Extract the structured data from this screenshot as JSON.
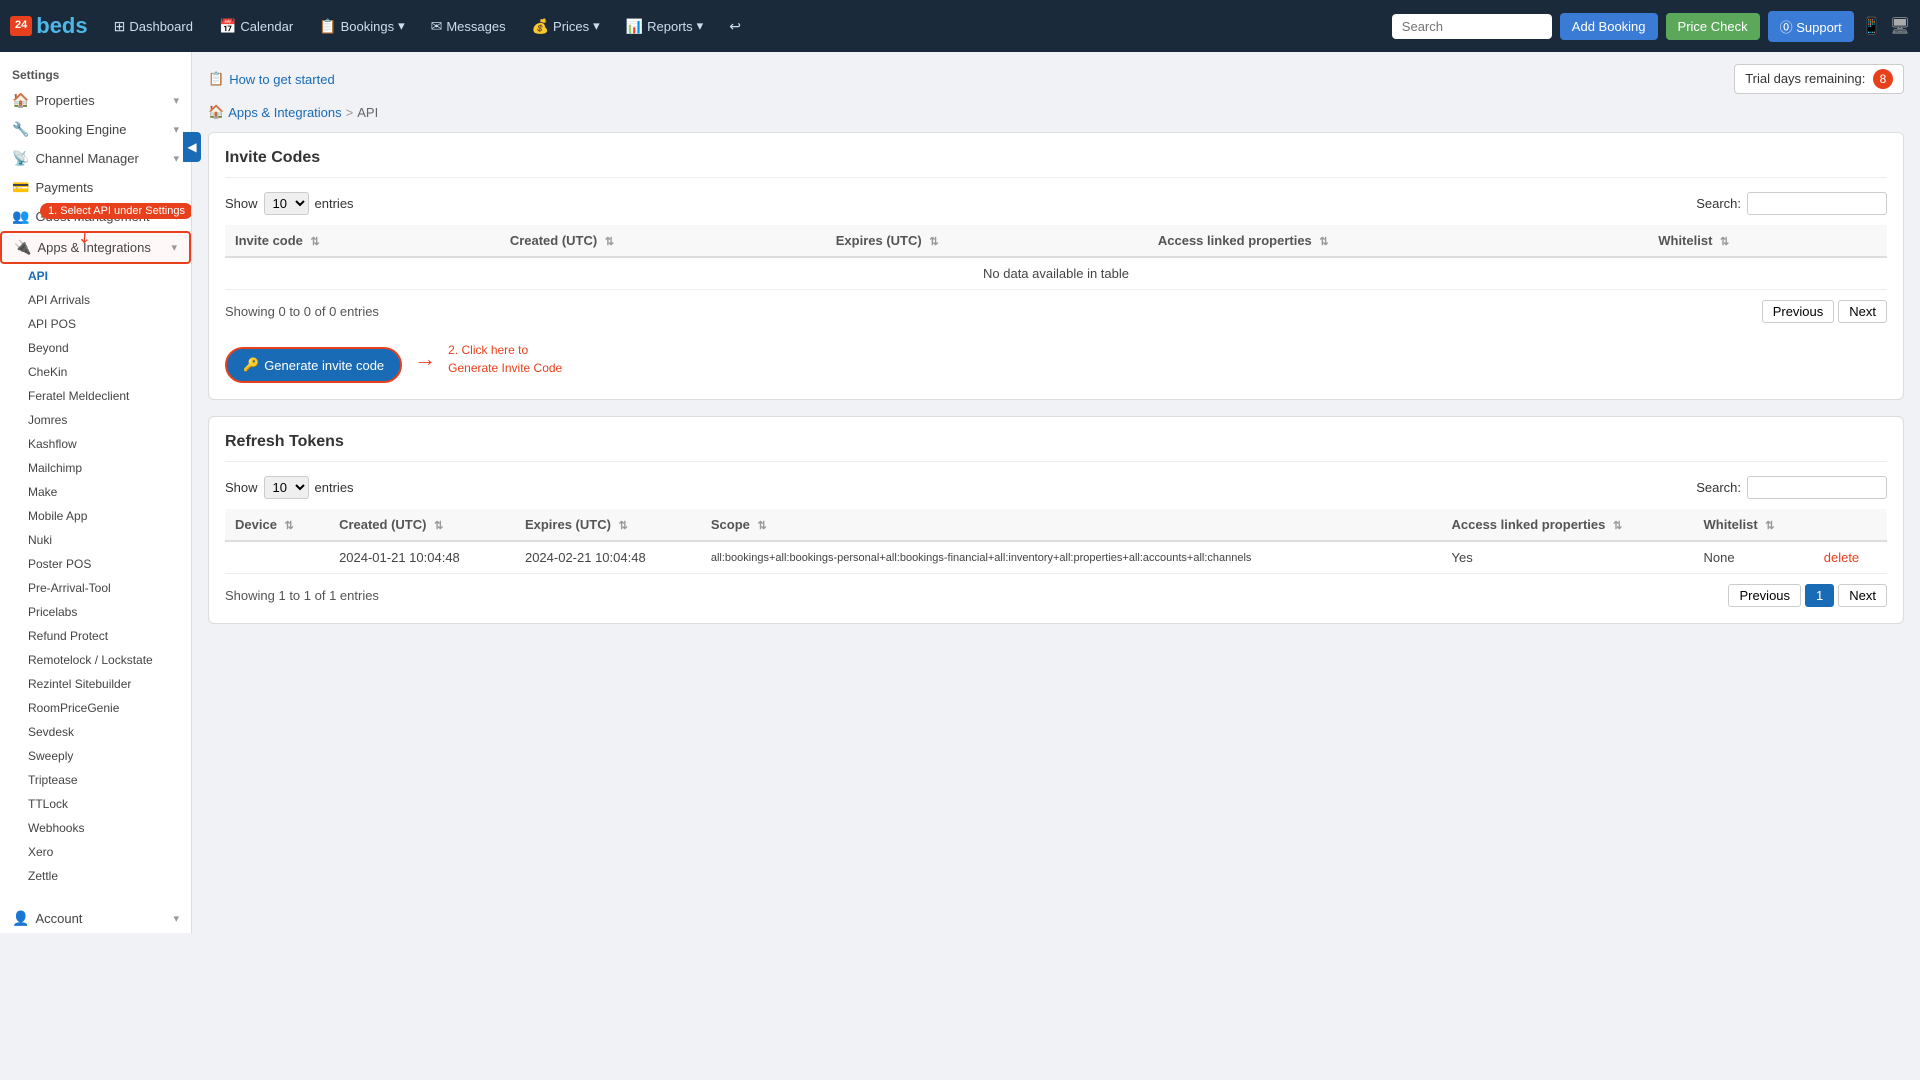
{
  "app": {
    "logo_top": "24",
    "logo_bottom": "beds"
  },
  "topnav": {
    "items": [
      {
        "id": "dashboard",
        "icon": "⊞",
        "label": "Dashboard"
      },
      {
        "id": "calendar",
        "icon": "📅",
        "label": "Calendar"
      },
      {
        "id": "bookings",
        "icon": "📋",
        "label": "Bookings",
        "dropdown": true
      },
      {
        "id": "messages",
        "icon": "✉",
        "label": "Messages"
      },
      {
        "id": "prices",
        "icon": "💰",
        "label": "Prices",
        "dropdown": true
      },
      {
        "id": "reports",
        "icon": "📊",
        "label": "Reports",
        "dropdown": true
      },
      {
        "id": "history",
        "icon": "↩",
        "label": ""
      }
    ],
    "search_placeholder": "Search",
    "add_booking_label": "Add Booking",
    "price_check_label": "Price Check",
    "support_label": "⓪ Support"
  },
  "trial": {
    "label": "Trial days remaining:",
    "days": "8"
  },
  "how_to": {
    "label": "How to get started"
  },
  "breadcrumb": {
    "parts": [
      "Apps & Integrations",
      ">",
      "API"
    ]
  },
  "sidebar": {
    "settings_label": "Settings",
    "items": [
      {
        "id": "properties",
        "icon": "🏠",
        "label": "Properties",
        "has_arrow": true
      },
      {
        "id": "booking-engine",
        "icon": "🔧",
        "label": "Booking Engine",
        "has_arrow": true
      },
      {
        "id": "channel-manager",
        "icon": "📡",
        "label": "Channel Manager",
        "has_arrow": true
      },
      {
        "id": "payments",
        "icon": "💳",
        "label": "Payments",
        "has_arrow": false
      },
      {
        "id": "guest-management",
        "icon": "👥",
        "label": "Guest Management",
        "has_arrow": true
      },
      {
        "id": "apps-integrations",
        "icon": "🔌",
        "label": "Apps & Integrations",
        "has_arrow": true,
        "active": true
      }
    ],
    "sub_items": [
      {
        "id": "api",
        "label": "API",
        "active": true
      },
      {
        "id": "api-arrivals",
        "label": "API Arrivals"
      },
      {
        "id": "api-pos",
        "label": "API POS"
      },
      {
        "id": "beyond",
        "label": "Beyond"
      },
      {
        "id": "chekin",
        "label": "CheKin"
      },
      {
        "id": "feratel",
        "label": "Feratel Meldeclient"
      },
      {
        "id": "jomres",
        "label": "Jomres"
      },
      {
        "id": "kashflow",
        "label": "Kashflow"
      },
      {
        "id": "mailchimp",
        "label": "Mailchimp"
      },
      {
        "id": "make",
        "label": "Make"
      },
      {
        "id": "mobile-app",
        "label": "Mobile App"
      },
      {
        "id": "nuki",
        "label": "Nuki"
      },
      {
        "id": "poster-pos",
        "label": "Poster POS"
      },
      {
        "id": "pre-arrival-tool",
        "label": "Pre-Arrival-Tool"
      },
      {
        "id": "pricelabs",
        "label": "Pricelabs"
      },
      {
        "id": "refund-protect",
        "label": "Refund Protect"
      },
      {
        "id": "remotelock",
        "label": "Remotelock / Lockstate"
      },
      {
        "id": "rezintel",
        "label": "Rezintel Sitebuilder"
      },
      {
        "id": "roompricegenie",
        "label": "RoomPriceGenie"
      },
      {
        "id": "sevdesk",
        "label": "Sevdesk"
      },
      {
        "id": "sweeply",
        "label": "Sweeply"
      },
      {
        "id": "triptease",
        "label": "Triptease"
      },
      {
        "id": "ttlock",
        "label": "TTLock"
      },
      {
        "id": "webhooks",
        "label": "Webhooks"
      },
      {
        "id": "xero",
        "label": "Xero"
      },
      {
        "id": "zettle",
        "label": "Zettle"
      }
    ],
    "account_label": "Account"
  },
  "invite_codes": {
    "title": "Invite Codes",
    "show_label": "Show",
    "show_value": "10",
    "entries_label": "entries",
    "search_label": "Search:",
    "search_value": "",
    "columns": [
      "Invite code",
      "Created (UTC)",
      "Expires (UTC)",
      "Access linked properties",
      "Whitelist"
    ],
    "no_data": "No data available in table",
    "showing": "Showing 0 to 0 of 0 entries",
    "prev_label": "Previous",
    "next_label": "Next",
    "generate_label": "Generate invite code",
    "annotation_step1": "1. Select API under Settings",
    "annotation_step2_line1": "2. Click here to",
    "annotation_step2_line2": "Generate Invite Code"
  },
  "refresh_tokens": {
    "title": "Refresh Tokens",
    "show_label": "Show",
    "show_value": "10",
    "entries_label": "entries",
    "search_label": "Search:",
    "search_value": "",
    "columns": [
      "Device",
      "Created (UTC)",
      "Expires (UTC)",
      "Scope",
      "Access linked properties",
      "Whitelist"
    ],
    "rows": [
      {
        "device": "",
        "created": "2024-01-21 10:04:48",
        "expires": "2024-02-21 10:04:48",
        "scope": "all:bookings+all:bookings-personal+all:bookings-financial+all:inventory+all:properties+all:accounts+all:channels",
        "access_linked": "Yes",
        "whitelist": "None",
        "delete_label": "delete"
      }
    ],
    "showing": "Showing 1 to 1 of 1 entries",
    "prev_label": "Previous",
    "page_num": "1",
    "next_label": "Next"
  }
}
